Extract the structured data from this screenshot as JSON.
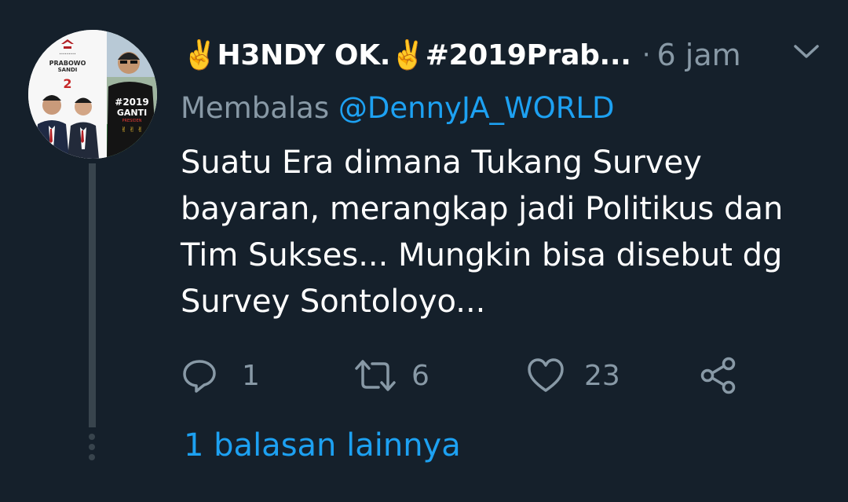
{
  "tweet": {
    "display_name": "✌️H3NDY OK.✌️#2019Prab...",
    "separator": "·",
    "timestamp": "6 jam",
    "reply_prefix": "Membalas",
    "reply_handle": "@DennyJA_WORLD",
    "text": "Suatu Era dimana Tukang Survey bayaran, merangkap jadi Politikus dan Tim Sukses... Mungkin bisa disebut dg Survey Sontoloyo...",
    "avatar": {
      "poster_top": "PRABOWO",
      "poster_bottom": "SANDI",
      "poster_number": "2",
      "shirt_lines": [
        "#2019",
        "GANTI",
        "PRESIDEN"
      ]
    }
  },
  "actions": {
    "reply_icon": "reply-icon",
    "reply_count": "1",
    "retweet_icon": "retweet-icon",
    "retweet_count": "6",
    "like_icon": "heart-icon",
    "like_count": "23",
    "share_icon": "share-icon"
  },
  "thread": {
    "more_replies": "1 balasan lainnya"
  },
  "colors": {
    "background": "#15202b",
    "secondary_text": "#8899a6",
    "accent": "#1da1f2",
    "thread_line": "#38444d"
  }
}
